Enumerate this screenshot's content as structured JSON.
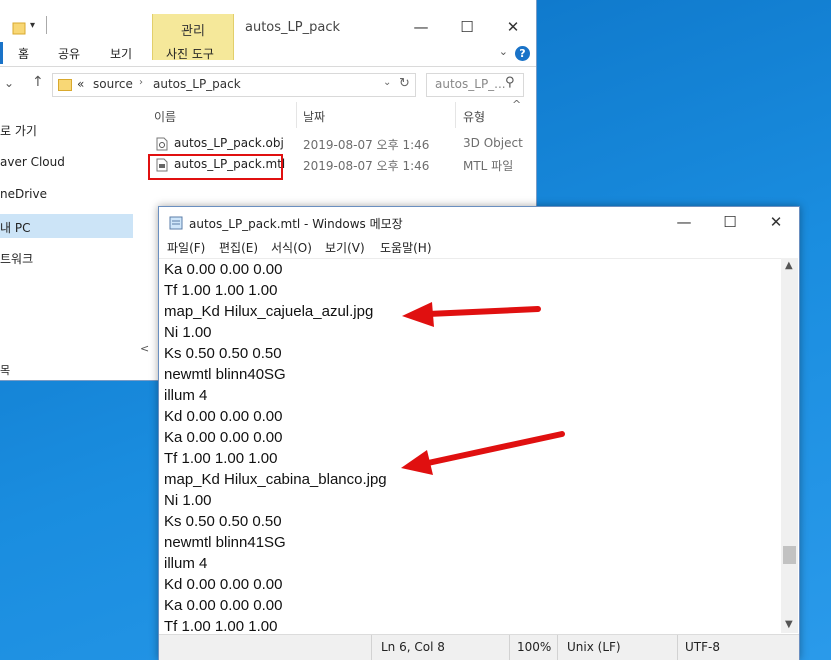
{
  "explorer": {
    "title": "autos_LP_pack",
    "context_tab": "관리",
    "ribbon_tabs": [
      "홈",
      "공유",
      "보기",
      "사진 도구"
    ],
    "address": {
      "prefix": "«",
      "segments": [
        "source",
        "autos_LP_pack"
      ]
    },
    "search_placeholder": "autos_LP_...",
    "nav_items": [
      "바로 가기",
      "Naver Cloud",
      "OneDrive",
      "내 PC",
      "네트워크"
    ],
    "nav_visible": [
      "로 가기",
      "aver Cloud",
      "neDrive",
      "내 PC",
      "트워크"
    ],
    "columns": {
      "name": "이름",
      "date": "날짜",
      "type": "유형"
    },
    "files": [
      {
        "name": "autos_LP_pack.obj",
        "date": "2019-08-07 오후 1:46",
        "type": "3D Object"
      },
      {
        "name": "autos_LP_pack.mtl",
        "date": "2019-08-07 오후 1:46",
        "type": "MTL 파일"
      }
    ],
    "status_fragment": "목"
  },
  "notepad": {
    "title": "autos_LP_pack.mtl - Windows 메모장",
    "menus": [
      "파일(F)",
      "편집(E)",
      "서식(O)",
      "보기(V)",
      "도움말(H)"
    ],
    "lines": [
      "Ka 0.00 0.00 0.00",
      "Tf 1.00 1.00 1.00",
      "map_Kd Hilux_cajuela_azul.jpg",
      "Ni 1.00",
      "Ks 0.50 0.50 0.50",
      "newmtl blinn40SG",
      "illum 4",
      "Kd 0.00 0.00 0.00",
      "Ka 0.00 0.00 0.00",
      "Tf 1.00 1.00 1.00",
      "map_Kd Hilux_cabina_blanco.jpg",
      "Ni 1.00",
      "Ks 0.50 0.50 0.50",
      "newmtl blinn41SG",
      "illum 4",
      "Kd 0.00 0.00 0.00",
      "Ka 0.00 0.00 0.00",
      "Tf 1.00 1.00 1.00"
    ],
    "status": {
      "position": "Ln 6, Col 8",
      "zoom": "100%",
      "line_ending": "Unix (LF)",
      "encoding": "UTF-8"
    }
  },
  "colors": {
    "desktop": "#1a8ddf",
    "highlight_box": "#e01010",
    "arrow": "#e01010",
    "context_tab": "#f5e89a",
    "nav_selected": "#cce4f7"
  }
}
